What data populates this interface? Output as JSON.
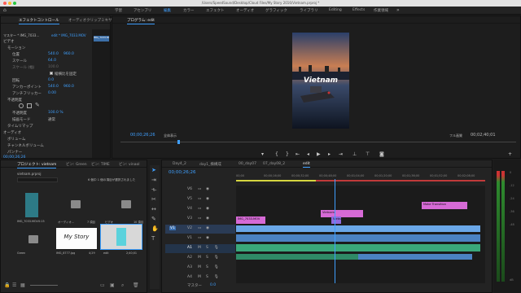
{
  "window": {
    "title": "/Users/SpeedSound/Desktop/Cloud Files/My Story 2016/Vietnam.prproj *"
  },
  "workspaces": [
    "学習",
    "アセンブリ",
    "編集",
    "カラー",
    "エフェクト",
    "オーディオ",
    "グラフィック",
    "ライブラリ",
    "Editing",
    "Effects",
    "作業領域"
  ],
  "active_workspace": "編集",
  "effect_controls": {
    "tabs": [
      "エフェクトコントロール",
      "オーディオクリップミキサー"
    ],
    "source_label": "マスター * IMG_7033...",
    "clip_label": "edit * IMG_7033.MOV",
    "section_video": "ビデオ",
    "motion": "モーション",
    "position_label": "位置",
    "position_x": "540.0",
    "position_y": "960.0",
    "scale_label": "スケール",
    "scale_value": "64.0",
    "scale_width_label": "スケール (幅)",
    "scale_width_value": "100.0",
    "uniform_scale_label": "縦横比を固定",
    "rotation_label": "回転",
    "rotation_value": "0.0",
    "anchor_label": "アンカーポイント",
    "anchor_x": "540.0",
    "anchor_y": "960.0",
    "flicker_label": "アンチフリッカー",
    "flicker_value": "0.00",
    "opacity": "不透明度",
    "opacity_label": "不透明度",
    "opacity_value": "100.0 %",
    "blend_label": "描画モード",
    "blend_value": "通常",
    "time_remap": "タイムリマップ",
    "section_audio": "オーディオ",
    "volume": "ボリューム",
    "channel_volume": "チャンネルボリューム",
    "panner": "パンナー",
    "clip_chip": "IMG_7033.MOV",
    "timecode": "00;00;26;26"
  },
  "program_monitor": {
    "tab": "プログラム: edit",
    "overlay_text": "Vietnam",
    "timecode": "00;00;26;26",
    "zoom": "全体表示",
    "quality": "フル画質",
    "duration": "00;02;40;01"
  },
  "project": {
    "tabs": [
      "プロジェクト: vietnam",
      "ビン: Green",
      "ビン: TIME",
      "ビン: vinaol"
    ],
    "project_name": "vietnam.prproj",
    "item_count": "6 個中 1 個の項目が選択されました",
    "items": [
      {
        "name": "IMG_7033.MOV",
        "dur": "0:15"
      },
      {
        "name": "オーディオ...",
        "dur": "7 項目"
      },
      {
        "name": "ビデオ",
        "dur": "10 項目"
      },
      {
        "name": "Green",
        "dur": ""
      },
      {
        "name": "IMG_8777.Jpg",
        "dur": "4;29"
      },
      {
        "name": "edit",
        "dur": "2;40;01"
      }
    ],
    "thumb_text": "My Story"
  },
  "timeline": {
    "tabs": [
      "Day4_2",
      "day1_横構成",
      "00_day07",
      "07_day08_2",
      "edit"
    ],
    "timecode": "00;00;26;26",
    "ruler": [
      "00;00",
      "00;00;16;00",
      "00;00;32;00",
      "00;00;48;00",
      "00;01;04;00",
      "00;01;20;00",
      "00;01;36;00",
      "00;01;52;00",
      "00;02;08;00",
      "00;02;24;00"
    ],
    "video_tracks": [
      "V6",
      "V5",
      "V4",
      "V3",
      "V2",
      "V1"
    ],
    "audio_tracks": [
      "A1",
      "A2",
      "A3",
      "A4"
    ],
    "master": "マスター",
    "master_value": "0.0",
    "clips": {
      "pink1": "IMG_7033.MOV",
      "pink2": "Vietnam",
      "pink3": "Make Transition",
      "purple1": "Vietnam"
    },
    "meter_labels": [
      "0",
      "-6",
      "-12",
      "-18",
      "-24",
      "-30",
      "-36",
      "-42",
      "-48",
      "-54",
      "dB"
    ]
  },
  "colors": {
    "accent": "#3fa0ff",
    "clip_video": "#6aa7e8",
    "clip_audio": "#3aa87a",
    "clip_pink": "#d66ad6",
    "clip_purple": "#8e6adf",
    "playhead": "#3fa0ff",
    "workarea": "#d6d640"
  }
}
